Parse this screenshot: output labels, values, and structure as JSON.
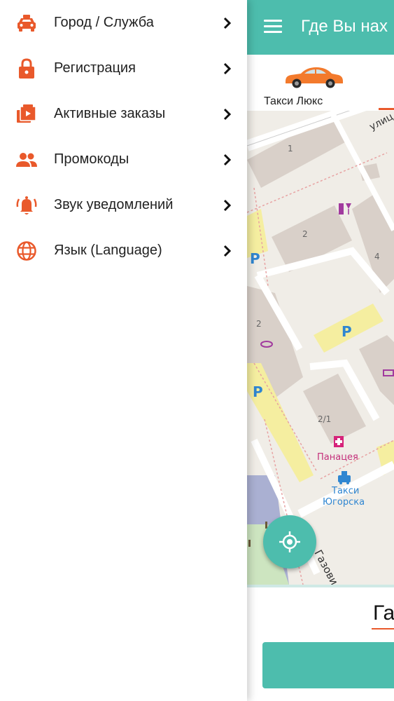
{
  "colors": {
    "accent": "#e9592b",
    "primary": "#4dbdad",
    "text": "#222222"
  },
  "drawer": {
    "items": [
      {
        "label": "Город / Служба",
        "icon": "taxi-icon"
      },
      {
        "label": "Регистрация",
        "icon": "lock-icon"
      },
      {
        "label": "Активные заказы",
        "icon": "orders-icon"
      },
      {
        "label": "Промокоды",
        "icon": "people-icon"
      },
      {
        "label": "Звук уведомлений",
        "icon": "bell-icon"
      },
      {
        "label": "Язык (Language)",
        "icon": "globe-icon"
      }
    ]
  },
  "appbar": {
    "title": "Где Вы нах"
  },
  "tariff": {
    "label": "Такси Люкс"
  },
  "map": {
    "labels": {
      "street_top": "улиц",
      "street_bottom": "Газови",
      "num1": "1",
      "num2a": "2",
      "num4": "4",
      "num2b": "2",
      "num21": "2/1",
      "pharmacy": "Панацея",
      "taxi_line1": "Такси",
      "taxi_line2": "Югорска"
    }
  },
  "bottom": {
    "address_partial": "Га"
  }
}
